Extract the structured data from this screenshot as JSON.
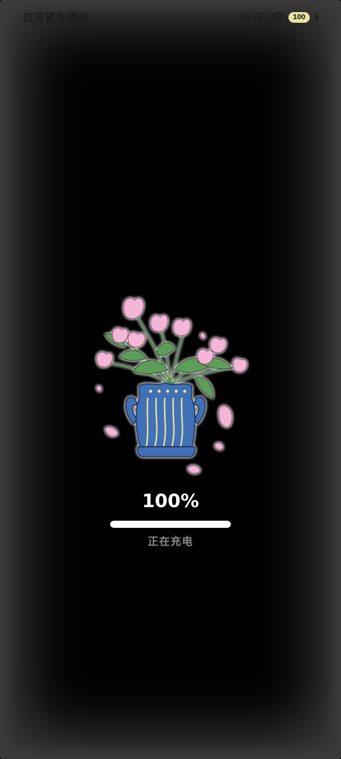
{
  "status_bar": {
    "carrier_text": "仅可紧急通话",
    "battery_level": "100",
    "icons": [
      "vibrate-icon",
      "hd-voice-icon",
      "wifi-icon",
      "battery-icon",
      "charging-bolt-icon"
    ]
  },
  "charging": {
    "percent_text": "100%",
    "progress": 1.0,
    "status_text": "正在充电"
  },
  "colors": {
    "background": "#000000",
    "vignette": "#3a3a3a",
    "progress_fill": "#ffffff",
    "battery_badge": "#e9e3a3",
    "vase": "#3f6fb5",
    "petals": "#f3b6d6",
    "leaves": "#5f9e5a"
  }
}
